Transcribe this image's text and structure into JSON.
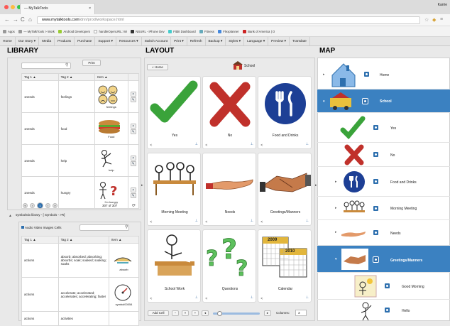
{
  "browser": {
    "tab_title": "— MyTalkTools",
    "user": "Karrie",
    "url_prefix": "www.mytalktools.com",
    "url_path": "/dnn/prod/workspace.html",
    "bookmarks": [
      "Apps",
      "— MyTalkTools > Work",
      "Android Developers",
      "handleOpenURL: Wi",
      "NSURL - iPhone Dev",
      "Fitbit Dashboard",
      "Fitness",
      "Flexplanner",
      "Bank of America | O"
    ]
  },
  "menu": [
    "Home",
    "Our Story ▾",
    "Media",
    "Products",
    "Purchase",
    "Support ▾",
    "Resources ▾",
    "Switch Account",
    "Print ▾",
    "Refresh",
    "Backup ▾",
    "Styles ▾",
    "Language ▾",
    "Preview ▾",
    "Translate"
  ],
  "library": {
    "title": "LIBRARY",
    "print_label": "Print",
    "headers": [
      "Tag 1 ▲",
      "Tag 2 ▲",
      "Item ▲"
    ],
    "rows": [
      {
        "tag1": "1needs",
        "tag2": "feelings",
        "item": "feelings"
      },
      {
        "tag1": "1needs",
        "tag2": "food",
        "item": "Food"
      },
      {
        "tag1": "1needs",
        "tag2": "help",
        "item": "help"
      },
      {
        "tag1": "1needs",
        "tag2": "hungry",
        "item": "I'm hungry"
      }
    ],
    "page_number": "1",
    "count": "307 of 307",
    "symbol_library": "symbolstix library - [ Symbols - >R]",
    "filters": "Audio Video Images Cells",
    "headers2": [
      "Tag 1 ▲",
      "Tag 2 ▲",
      "Item ▲"
    ],
    "rows2": [
      {
        "tag1": "actions",
        "tag2": "absorb; absorbed; absorbing; absorbs; soak; soaked; soaking; soaks",
        "item": "absorb"
      },
      {
        "tag1": "actions",
        "tag2": "accelerate; accelerated; accelerates; accelerating; faster",
        "item": "symbol00054"
      },
      {
        "tag1": "actions",
        "tag2": "activities",
        "item": ""
      }
    ]
  },
  "layout": {
    "title": "LAYOUT",
    "home_button": "« Home",
    "board_name": "School",
    "cells": [
      "Yes",
      "No",
      "Food and Drinks",
      "Morning Meeting",
      "Needs",
      "Greetings/Manners",
      "School Work",
      "Questions",
      "Calendar"
    ],
    "calendar_years": [
      "2009",
      "2010"
    ],
    "add_cell": "Add Cell",
    "columns_label": "Columns:",
    "columns_value": "3"
  },
  "map": {
    "title": "MAP",
    "items": [
      "Home",
      "School",
      "Yes",
      "No",
      "Food and Drinks",
      "Morning Meeting",
      "Needs",
      "Greetings/Manners",
      "Good Morning",
      "Hello"
    ]
  },
  "colors": {
    "accent": "#3b81c1",
    "check": "#3aa33a",
    "cross": "#c0312b",
    "plate": "#1d3f95"
  }
}
